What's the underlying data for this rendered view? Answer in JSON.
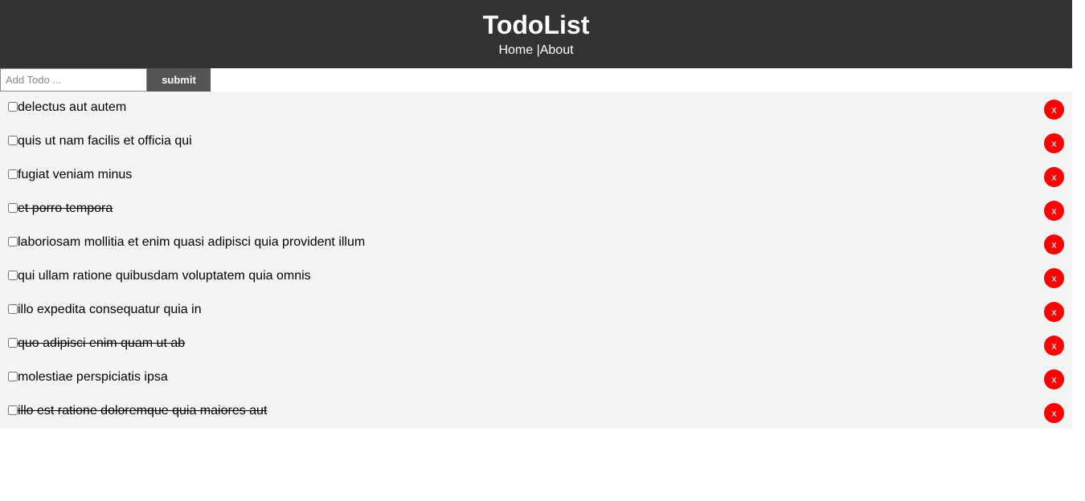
{
  "header": {
    "title": "TodoList",
    "nav_home": "Home",
    "nav_separator": " |",
    "nav_about": "About"
  },
  "form": {
    "placeholder": "Add Todo ...",
    "value": "",
    "submit_label": "submit"
  },
  "colors": {
    "header_bg": "#333333",
    "list_bg": "#f4f4f4",
    "delete_button": "#ff0000",
    "submit_button": "#555555"
  },
  "todos": [
    {
      "title": "delectus aut autem",
      "completed": false,
      "delete_label": "x"
    },
    {
      "title": "quis ut nam facilis et officia qui",
      "completed": false,
      "delete_label": "x"
    },
    {
      "title": "fugiat veniam minus",
      "completed": false,
      "delete_label": "x"
    },
    {
      "title": "et porro tempora",
      "completed": true,
      "delete_label": "x"
    },
    {
      "title": "laboriosam mollitia et enim quasi adipisci quia provident illum",
      "completed": false,
      "delete_label": "x"
    },
    {
      "title": "qui ullam ratione quibusdam voluptatem quia omnis",
      "completed": false,
      "delete_label": "x"
    },
    {
      "title": "illo expedita consequatur quia in",
      "completed": false,
      "delete_label": "x"
    },
    {
      "title": "quo adipisci enim quam ut ab",
      "completed": true,
      "delete_label": "x"
    },
    {
      "title": "molestiae perspiciatis ipsa",
      "completed": false,
      "delete_label": "x"
    },
    {
      "title": "illo est ratione doloremque quia maiores aut",
      "completed": true,
      "delete_label": "x"
    }
  ]
}
